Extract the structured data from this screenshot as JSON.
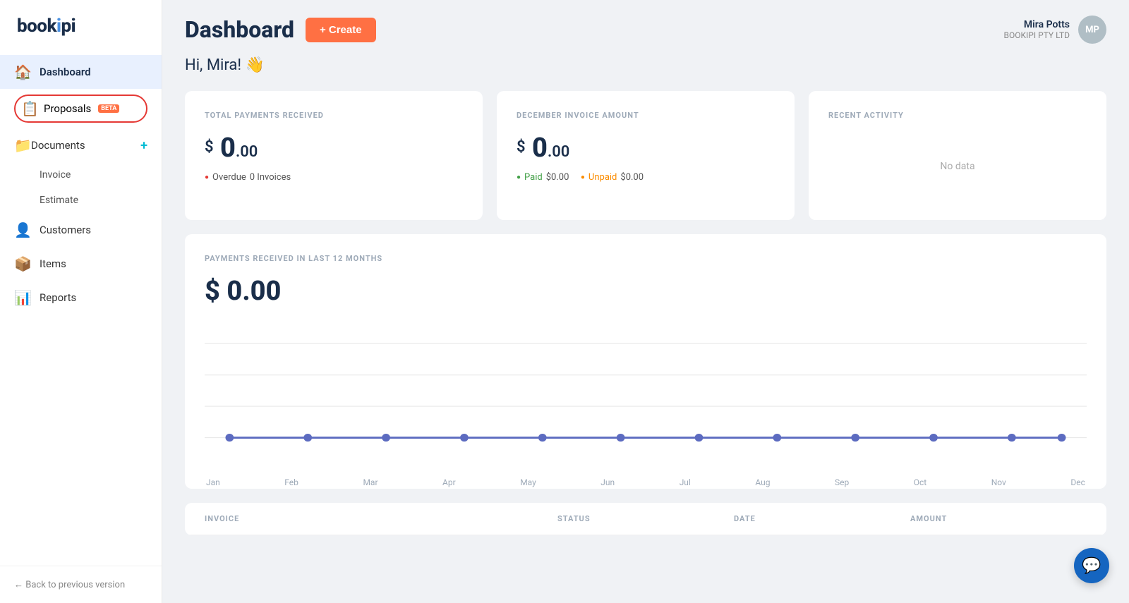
{
  "logo": {
    "text": "book",
    "highlight": "i",
    "rest": "pi"
  },
  "sidebar": {
    "items": [
      {
        "id": "dashboard",
        "label": "Dashboard",
        "icon": "🏠",
        "active": true
      },
      {
        "id": "proposals",
        "label": "Proposals",
        "icon": "📋",
        "beta": true,
        "highlighted": true
      },
      {
        "id": "documents",
        "label": "Documents",
        "icon": "📁",
        "hasPlus": true
      },
      {
        "id": "invoice",
        "label": "Invoice",
        "sub": true
      },
      {
        "id": "estimate",
        "label": "Estimate",
        "sub": true
      },
      {
        "id": "customers",
        "label": "Customers",
        "icon": "👤"
      },
      {
        "id": "items",
        "label": "Items",
        "icon": "📦"
      },
      {
        "id": "reports",
        "label": "Reports",
        "icon": "📊"
      }
    ],
    "footer": "← Back to previous version"
  },
  "header": {
    "title": "Dashboard",
    "create_btn": "+ Create",
    "user": {
      "name": "Mira Potts",
      "company": "BOOKIPI PTY LTD",
      "initials": "MP"
    }
  },
  "greeting": "Hi, Mira! 👋",
  "cards": {
    "total_payments": {
      "title": "TOTAL PAYMENTS RECEIVED",
      "dollar": "$",
      "amount": "0",
      "cents": ".00",
      "overdue_label": "Overdue",
      "overdue_value": "0 Invoices"
    },
    "december_invoice": {
      "title": "DECEMBER INVOICE AMOUNT",
      "dollar": "$",
      "amount": "0",
      "cents": ".00",
      "paid_label": "Paid",
      "paid_value": "$0.00",
      "unpaid_label": "Unpaid",
      "unpaid_value": "$0.00"
    },
    "recent_activity": {
      "title": "RECENT ACTIVITY",
      "no_data": "No data"
    }
  },
  "chart": {
    "title": "PAYMENTS RECEIVED IN LAST 12 MONTHS",
    "dollar": "$",
    "amount": "0",
    "cents": ".00",
    "months": [
      "Jan",
      "Feb",
      "Mar",
      "Apr",
      "May",
      "Jun",
      "Jul",
      "Aug",
      "Sep",
      "Oct",
      "Nov",
      "Dec"
    ],
    "values": [
      0,
      0,
      0,
      0,
      0,
      0,
      0,
      0,
      0,
      0,
      0,
      0
    ]
  },
  "table": {
    "columns": [
      "INVOICE",
      "STATUS",
      "DATE",
      "AMOUNT"
    ]
  }
}
